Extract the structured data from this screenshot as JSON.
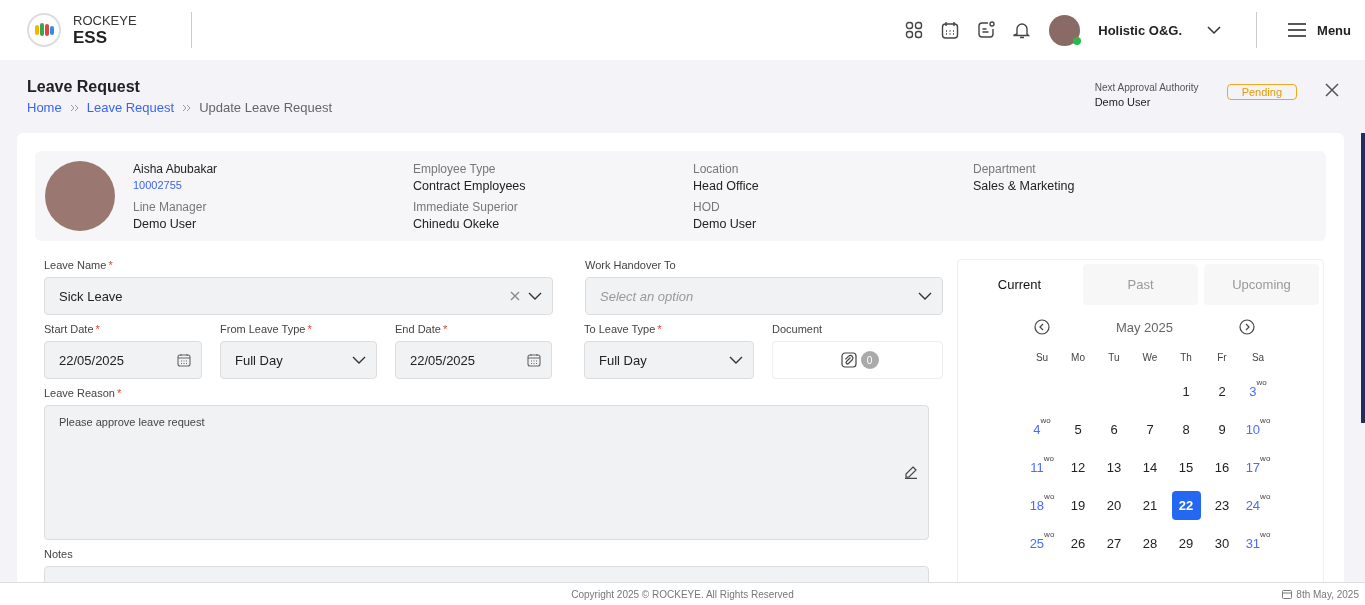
{
  "header": {
    "brand_top": "ROCKEYE",
    "brand": "ESS",
    "org": "Holistic O&G.",
    "user_online": true,
    "menu": "Menu"
  },
  "page": {
    "title": "Leave Request",
    "breadcrumbs": [
      {
        "label": "Home",
        "link": true
      },
      {
        "label": "Leave Request",
        "link": true
      },
      {
        "label": "Update Leave Request",
        "link": false
      }
    ],
    "approval_label": "Next Approval Authority",
    "approval_value": "Demo User",
    "status": "Pending"
  },
  "employee": {
    "name": "Aisha Abubakar",
    "id": "10002755",
    "details": [
      {
        "label": "Employee Type",
        "value": "Contract Employees"
      },
      {
        "label": "Location",
        "value": "Head Office"
      },
      {
        "label": "Department",
        "value": "Sales & Marketing"
      },
      {
        "label": "Line Manager",
        "value": "Demo User"
      },
      {
        "label": "Immediate Superior",
        "value": "Chinedu Okeke"
      },
      {
        "label": "HOD",
        "value": "Demo User"
      }
    ]
  },
  "form": {
    "fields": [
      {
        "kind": "select",
        "label": "Leave Name",
        "required_mark": "*",
        "value": "Sick Leave",
        "clearable": true
      },
      {
        "kind": "select",
        "label": "Work Handover To",
        "placeholder": "Select an option",
        "clearable": false
      },
      {
        "kind": "date",
        "label": "Start Date",
        "required_mark": "*",
        "value": "22/05/2025"
      },
      {
        "kind": "select",
        "label": "From Leave Type",
        "required_mark": "*",
        "value": "Full Day",
        "clearable": false
      },
      {
        "kind": "date",
        "label": "End Date",
        "required_mark": "*",
        "value": "22/05/2025"
      },
      {
        "kind": "select",
        "label": "To Leave Type",
        "required_mark": "*",
        "value": "Full Day",
        "clearable": false
      },
      {
        "kind": "document",
        "label": "Document",
        "count": "0"
      },
      {
        "kind": "textarea",
        "label": "Leave Reason",
        "required_mark": "*",
        "value": "Please approve leave request",
        "editable": true
      },
      {
        "kind": "textarea",
        "label": "Notes",
        "editable": false
      }
    ]
  },
  "calendar": {
    "tabs": [
      {
        "label": "Current",
        "selected": true
      },
      {
        "label": "Past",
        "selected": false
      },
      {
        "label": "Upcoming",
        "selected": false
      }
    ],
    "month": "May 2025",
    "weekdays": [
      "Su",
      "Mo",
      "Tu",
      "We",
      "Th",
      "Fr",
      "Sa"
    ],
    "days": [
      {
        "kind": "blank"
      },
      {
        "kind": "blank"
      },
      {
        "kind": "blank"
      },
      {
        "kind": "blank"
      },
      {
        "kind": "day",
        "day": "1",
        "weekoff": false,
        "selected": false
      },
      {
        "kind": "day",
        "day": "2",
        "weekoff": false,
        "selected": false
      },
      {
        "kind": "day",
        "day": "3",
        "weekoff": true,
        "mark": "wo",
        "selected": false
      },
      {
        "kind": "day",
        "day": "4",
        "weekoff": true,
        "mark": "wo",
        "selected": false
      },
      {
        "kind": "day",
        "day": "5",
        "weekoff": false,
        "selected": false
      },
      {
        "kind": "day",
        "day": "6",
        "weekoff": false,
        "selected": false
      },
      {
        "kind": "day",
        "day": "7",
        "weekoff": false,
        "selected": false
      },
      {
        "kind": "day",
        "day": "8",
        "weekoff": false,
        "selected": false
      },
      {
        "kind": "day",
        "day": "9",
        "weekoff": false,
        "selected": false
      },
      {
        "kind": "day",
        "day": "10",
        "weekoff": true,
        "mark": "wo",
        "selected": false
      },
      {
        "kind": "day",
        "day": "11",
        "weekoff": true,
        "mark": "wo",
        "selected": false
      },
      {
        "kind": "day",
        "day": "12",
        "weekoff": false,
        "selected": false
      },
      {
        "kind": "day",
        "day": "13",
        "weekoff": false,
        "selected": false
      },
      {
        "kind": "day",
        "day": "14",
        "weekoff": false,
        "selected": false
      },
      {
        "kind": "day",
        "day": "15",
        "weekoff": false,
        "selected": false
      },
      {
        "kind": "day",
        "day": "16",
        "weekoff": false,
        "selected": false
      },
      {
        "kind": "day",
        "day": "17",
        "weekoff": true,
        "mark": "wo",
        "selected": false
      },
      {
        "kind": "day",
        "day": "18",
        "weekoff": true,
        "mark": "wo",
        "selected": false
      },
      {
        "kind": "day",
        "day": "19",
        "weekoff": false,
        "selected": false
      },
      {
        "kind": "day",
        "day": "20",
        "weekoff": false,
        "selected": false
      },
      {
        "kind": "day",
        "day": "21",
        "weekoff": false,
        "selected": false
      },
      {
        "kind": "day",
        "day": "22",
        "weekoff": false,
        "selected": true
      },
      {
        "kind": "day",
        "day": "23",
        "weekoff": false,
        "selected": false
      },
      {
        "kind": "day",
        "day": "24",
        "weekoff": true,
        "mark": "wo",
        "selected": false
      },
      {
        "kind": "day",
        "day": "25",
        "weekoff": true,
        "mark": "wo",
        "selected": false
      },
      {
        "kind": "day",
        "day": "26",
        "weekoff": false,
        "selected": false
      },
      {
        "kind": "day",
        "day": "27",
        "weekoff": false,
        "selected": false
      },
      {
        "kind": "day",
        "day": "28",
        "weekoff": false,
        "selected": false
      },
      {
        "kind": "day",
        "day": "29",
        "weekoff": false,
        "selected": false
      },
      {
        "kind": "day",
        "day": "30",
        "weekoff": false,
        "selected": false
      },
      {
        "kind": "day",
        "day": "31",
        "weekoff": true,
        "mark": "wo",
        "selected": false
      }
    ]
  },
  "footer": {
    "copyright": "Copyright 2025 © ROCKEYE. All Rights Reserved",
    "date": "8th May, 2025"
  }
}
